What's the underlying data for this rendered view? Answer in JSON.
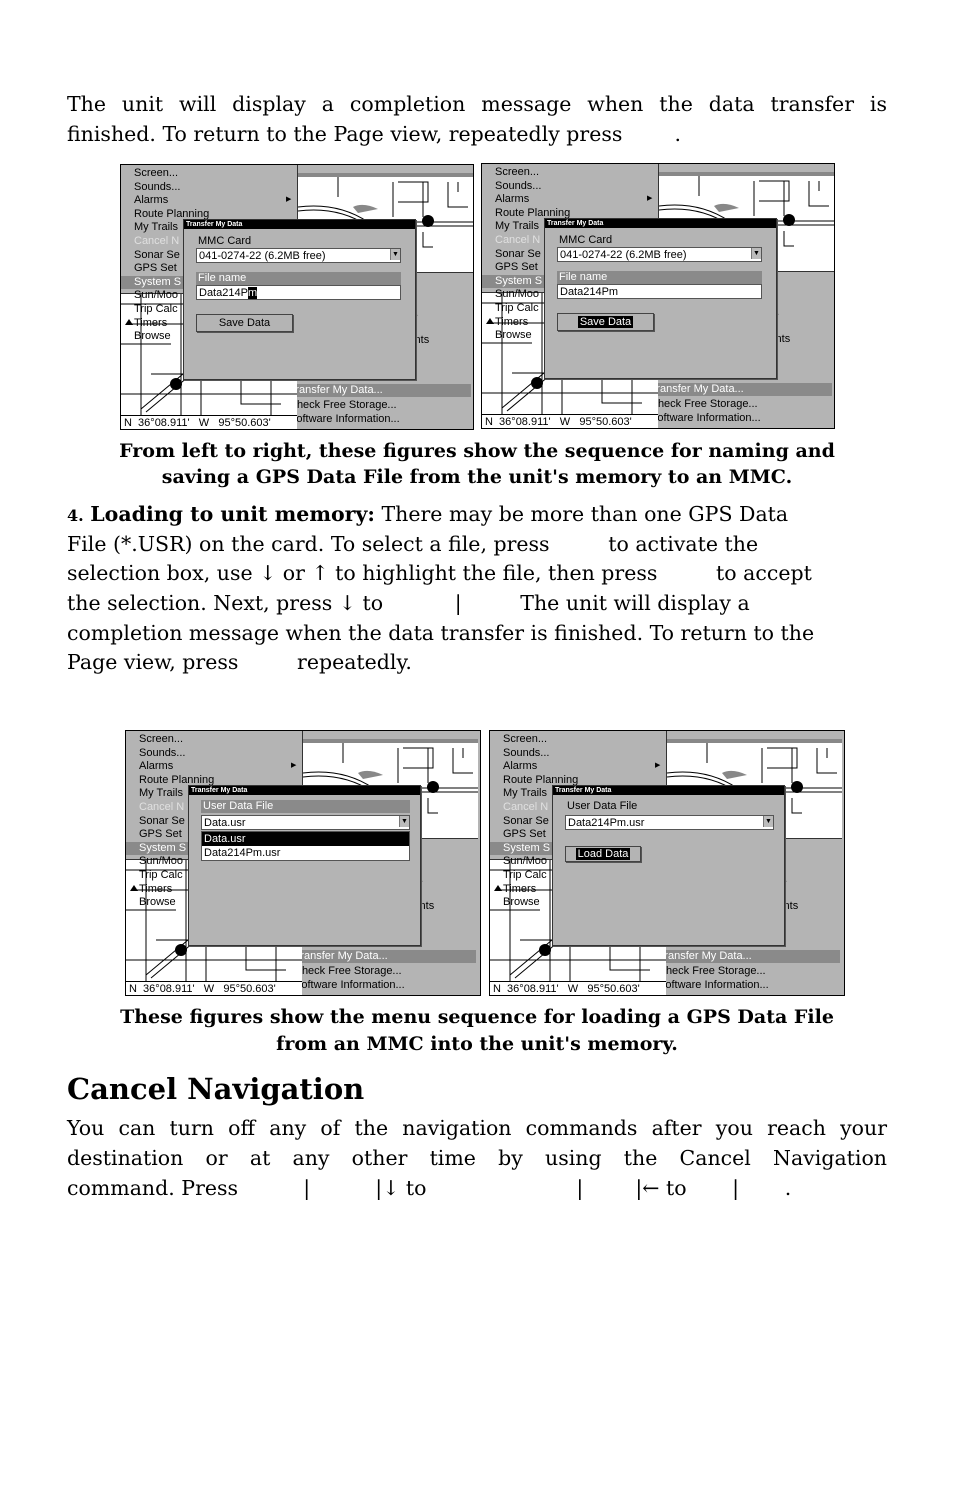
{
  "paragraph1": {
    "line1": "The unit will display a completion message when the data transfer is",
    "line2": "finished. To return to the Page view, repeatedly press        ."
  },
  "caption1": {
    "line1": "From left to right, these figures show the sequence for naming and",
    "line2": "saving a GPS Data File from the unit's memory to an MMC."
  },
  "step4": {
    "number": "4.",
    "title": "Loading to unit memory:",
    "line1_rest": " There may be more than one GPS Data",
    "line2": "File (*.USR) on the card. To select a file, press         to activate the",
    "line3": "selection box, use ↓ or ↑ to highlight the file, then press         to accept",
    "line4": "the selection. Next, press ↓ to           |         The unit will display a",
    "line5": "completion message when the data transfer is finished. To return to the",
    "line6": "Page view, press         repeatedly."
  },
  "caption2": {
    "line1": "These figures show the menu sequence for loading a GPS Data File",
    "line2": "from an MMC into the unit's memory."
  },
  "cancel_nav": {
    "heading": "Cancel Navigation",
    "line1": "You can turn off any of the navigation commands after you reach your",
    "line2": "destination or at any other time by using the Cancel Navigation",
    "line3": "command. Press          |          |↓ to                       |        |← to       |       ."
  },
  "screens": [
    {
      "left_menu": [
        "Screen...",
        "Sounds...",
        "Alarms",
        "Route Planning",
        "My Trails",
        "Cancel N",
        "Sonar Se",
        "GPS Set",
        "System S",
        "Sun/Moo",
        "Trip Calc",
        "Timers",
        "Browse"
      ],
      "right_menu": {
        "item_a": "t...",
        "item_b": "oints",
        "transfer": "Transfer My Data...",
        "check": "Check Free Storage...",
        "software": "Software Information..."
      },
      "status": "N  36°08.911'   W   95°50.603'",
      "dialog": {
        "type": "save",
        "title": "Transfer My Data",
        "card_label": "MMC Card",
        "card_value": "041-0274-22 (6.2MB free)",
        "file_label": "File name",
        "file_value": "Data214P",
        "file_cursor": "m",
        "button": "Save Data",
        "button_selected": false
      }
    },
    {
      "left_menu": [
        "Screen...",
        "Sounds...",
        "Alarms",
        "Route Planning",
        "My Trails",
        "Cancel N",
        "Sonar Se",
        "GPS Set",
        "System S",
        "Sun/Moo",
        "Trip Calc",
        "Timers",
        "Browse"
      ],
      "right_menu": {
        "item_a": "t...",
        "item_b": "oints",
        "transfer": "Transfer My Data...",
        "check": "Check Free Storage...",
        "software": "Software Information..."
      },
      "status": "N  36°08.911'   W   95°50.603'",
      "dialog": {
        "type": "save",
        "title": "Transfer My Data",
        "card_label": "MMC Card",
        "card_value": "041-0274-22 (6.2MB free)",
        "file_label": "File name",
        "file_value": "Data214Pm",
        "file_cursor": "",
        "button": "Save Data",
        "button_selected": true
      }
    },
    {
      "left_menu": [
        "Screen...",
        "Sounds...",
        "Alarms",
        "Route Planning",
        "My Trails",
        "Cancel N",
        "Sonar Se",
        "GPS Set",
        "System S",
        "Sun/Moo",
        "Trip Calc",
        "Timers",
        "Browse"
      ],
      "right_menu": {
        "item_a": "t...",
        "item_b": "oints",
        "transfer": "Transfer My Data...",
        "check": "Check Free Storage...",
        "software": "Software Information..."
      },
      "status": "N  36°08.911'   W   95°50.603'",
      "dialog": {
        "type": "load",
        "title": "Transfer My Data",
        "file_label": "User Data File",
        "header_selected": true,
        "file_value": "Data.usr",
        "list": [
          "Data.usr",
          "Data214Pm.usr"
        ],
        "list_selected": 0
      }
    },
    {
      "left_menu": [
        "Screen...",
        "Sounds...",
        "Alarms",
        "Route Planning",
        "My Trails",
        "Cancel N",
        "Sonar Se",
        "GPS Set",
        "System S",
        "Sun/Moo",
        "Trip Calc",
        "Timers",
        "Browse"
      ],
      "right_menu": {
        "item_a": "t...",
        "item_b": "oints",
        "transfer": "Transfer My Data...",
        "check": "Check Free Storage...",
        "software": "Software Information..."
      },
      "status": "N  36°08.911'   W   95°50.603'",
      "dialog": {
        "type": "load",
        "title": "Transfer My Data",
        "file_label": "User Data File",
        "header_selected": false,
        "file_value": "Data214Pm.usr",
        "button": "Load Data",
        "button_selected": true
      }
    }
  ]
}
